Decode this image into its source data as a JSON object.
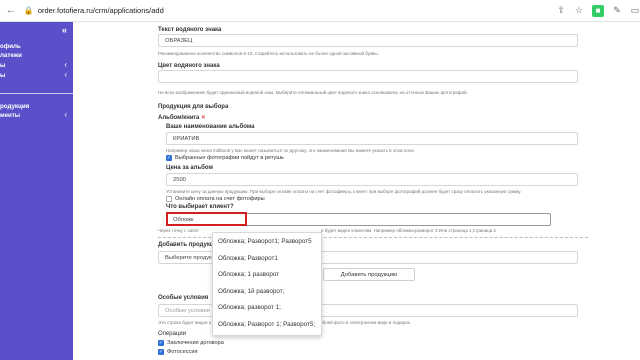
{
  "browser": {
    "url": "order.fotofiera.ru/crm/applications/add"
  },
  "sidebar": {
    "collapse_glyph": "«",
    "items": [
      {
        "label": "офиль"
      },
      {
        "label": "латежи"
      },
      {
        "label": "ы"
      },
      {
        "label": "ы"
      },
      {
        "label": "родукция"
      },
      {
        "label": "менты"
      }
    ]
  },
  "form": {
    "watermark_text_label": "Текст водяного знака",
    "watermark_text_value": "ОБРАЗЕЦ",
    "watermark_text_hint": "Рекомендованное количество символов 5-10, старайтесь использовать не более одной заглавной буквы.",
    "watermark_color_label": "Цвет водяного знака",
    "watermark_color_hint": "На всех изображениях будет одинаковый водяной знак. Выберите оптимальный цвет водяного знака основываясь на оттенках Ваших фотографий.",
    "products_label": "Продукция для выбора",
    "album_label": "Альбом/книга",
    "remove_glyph": "×",
    "album_name_label": "Ваше наименование альбома",
    "album_name_value": "КРИАТИВ",
    "album_name_hint": "Например наша книга Indibook у Вас может называться по другому, это наименование Вы можете указать в этом поле.",
    "retouch_label": "Выбранные фотографии пойдут в ретушь",
    "price_label": "Цена за альбом",
    "price_value": "2500",
    "price_hint": "Установите цену за данную продукцию. При выборе онлайн оплаты на счет фотофиеры, клиент при выборе фотографий должен будет сразу оплатить указанную сумму.",
    "online_pay_label": "Онлайн оплата на счет фотофиры",
    "client_choice_label": "Что выбирает клиент?",
    "client_choice_value": "Обложк",
    "client_choice_hint_left": "Через точку с запят",
    "client_choice_hint_right": "р будет виден клиентам. Например обложка;разворот 3 Или страница 1;страница 2",
    "add_product_label": "Добавить продукцию",
    "add_product_placeholder": "Выберите продукци",
    "add_product_button": "Добавить продукцию",
    "special_label": "Особые условия",
    "special_placeholder": "Особые условия",
    "special_hint_left": "Эта строка будет видна к",
    "special_hint_right": "рублей фото в электронном виде в подарок.",
    "operations_label": "Операции",
    "contract_label": "Заключения договора",
    "photoshoot_label": "Фотосессия"
  },
  "autocomplete": {
    "options": [
      "Обложка; Разворот1; Разворот5",
      "Обложка; Разворот1",
      "Обложка; 1 разворот",
      "Обложка; 1й разворот;",
      "Обложка; разворот 1;",
      "Обложка; Разворот 1; Разворот5;"
    ]
  },
  "colors": {
    "sidebar_bg": "#5a50c9",
    "checkbox_blue": "#2f6fd8",
    "highlight_red": "#d02020"
  }
}
